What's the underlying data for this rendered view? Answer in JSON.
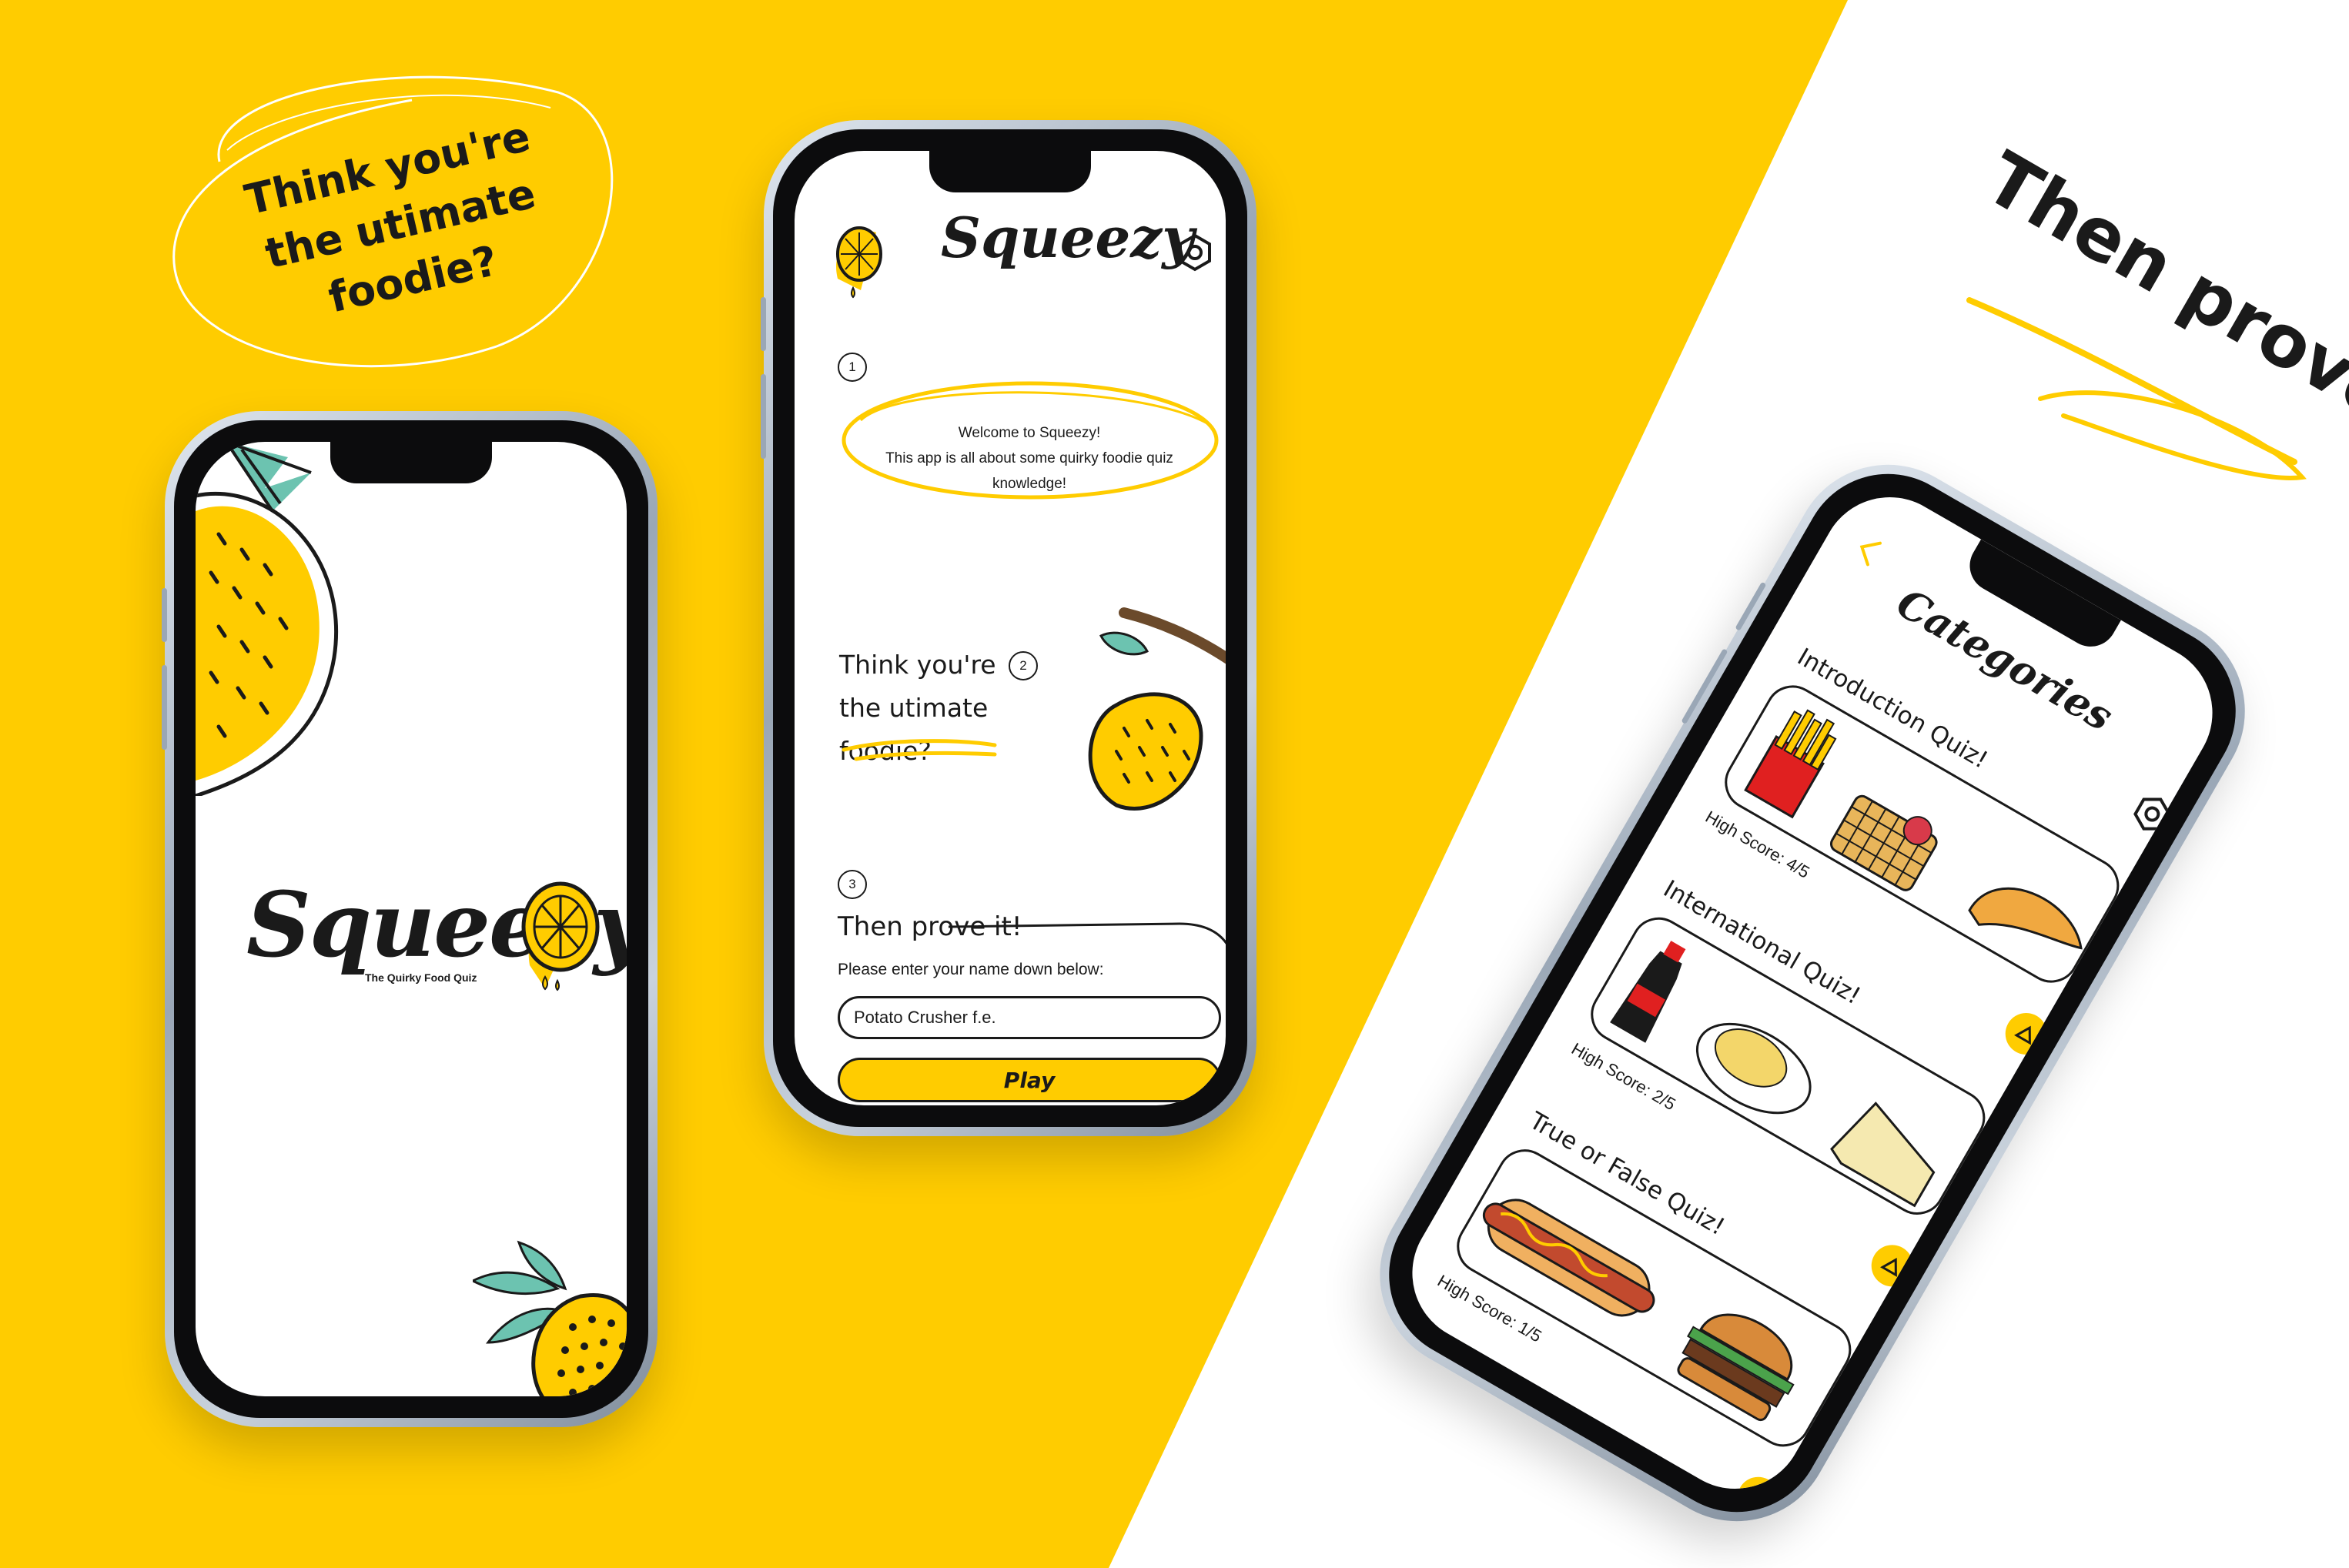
{
  "colors": {
    "accent": "#FFCC00",
    "ink": "#1A1A1A",
    "leaf": "#6CC3B0",
    "background": "#FFFFFF"
  },
  "headline": {
    "left": "Think you're the utimate foodie?",
    "right": "Then prove it!"
  },
  "splash": {
    "logo": "Squeezy",
    "tagline": "The Quirky Food Quiz"
  },
  "welcome": {
    "title": "Squeezy",
    "settings_icon": "gear-icon",
    "steps": [
      {
        "number": "1",
        "lines": [
          "Welcome to Squeezy!",
          "This app is all about some quirky foodie quiz knowledge!"
        ]
      },
      {
        "number": "2",
        "text": "Think you're the utimate foodie?"
      },
      {
        "number": "3",
        "text": "Then prove it!"
      }
    ],
    "name_prompt": "Please enter your name down below:",
    "name_value": "Potato Crusher f.e.",
    "play_label": "Play"
  },
  "categories": {
    "title": "Categories",
    "back_icon": "chevron-left-icon",
    "settings_icon": "gear-icon",
    "items": [
      {
        "name": "Introduction Quiz!",
        "score_label": "High Score:",
        "score": "4/5",
        "images": [
          "fries",
          "waffle",
          "croissant"
        ]
      },
      {
        "name": "International Quiz!",
        "score_label": "High Score:",
        "score": "2/5",
        "images": [
          "cola",
          "pasta",
          "cheese"
        ]
      },
      {
        "name": "True or False Quiz!",
        "score_label": "High Score:",
        "score": "1/5",
        "images": [
          "hotdog",
          "burger"
        ]
      }
    ]
  }
}
